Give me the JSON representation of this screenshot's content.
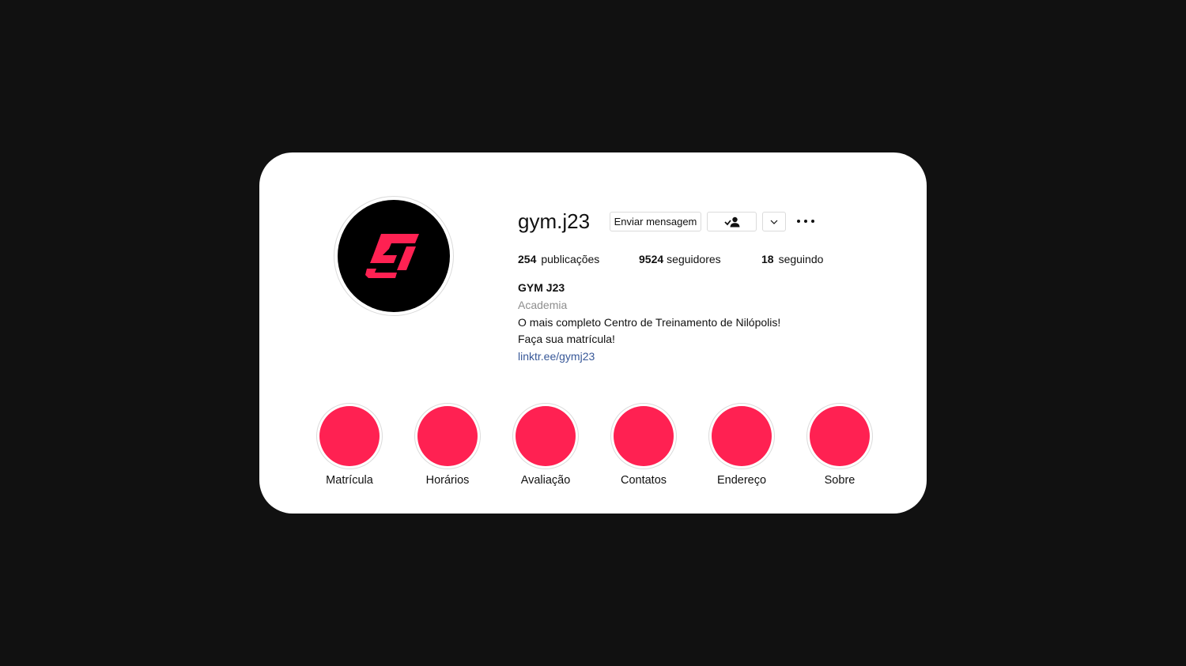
{
  "colors": {
    "background": "#111111",
    "card": "#ffffff",
    "brand_accent": "#ff2152",
    "link": "#385898",
    "muted": "#8e8e8e"
  },
  "profile": {
    "username": "gym.j23",
    "logo_icon": "gym-j23-logo-icon"
  },
  "actions": {
    "message_label": "Enviar mensagem",
    "follow_icon": "person-check-icon",
    "dropdown_icon": "chevron-down-icon",
    "more_icon": "more-options-icon"
  },
  "stats": {
    "posts_count": "254",
    "posts_label": "publicações",
    "followers_count": "9524",
    "followers_label": "seguidores",
    "following_count": "18",
    "following_label": "seguindo"
  },
  "bio": {
    "name": "GYM J23",
    "category": "Academia",
    "line1": "O mais completo Centro de Treinamento de Nilópolis!",
    "line2": "Faça sua matrícula!",
    "link": "linktr.ee/gymj23"
  },
  "highlights": [
    {
      "label": "Matrícula"
    },
    {
      "label": "Horários"
    },
    {
      "label": "Avaliação"
    },
    {
      "label": "Contatos"
    },
    {
      "label": "Endereço"
    },
    {
      "label": "Sobre"
    }
  ]
}
